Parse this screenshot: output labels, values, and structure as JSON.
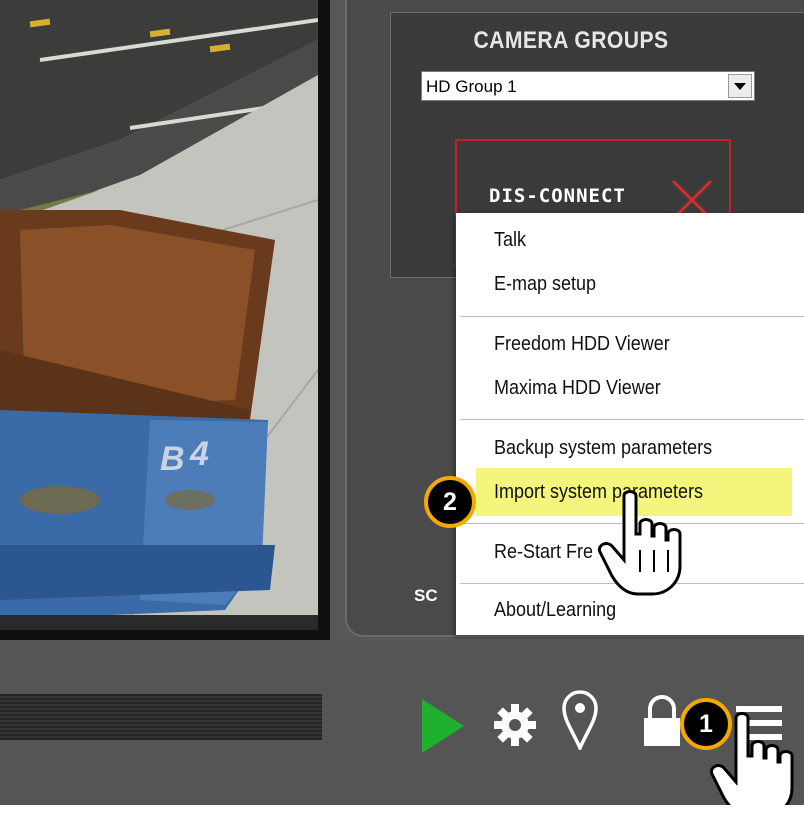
{
  "camera_groups": {
    "title": "CAMERA GROUPS",
    "selected_group": "HD Group 1"
  },
  "disconnect_label": "DIS-CONNECT",
  "partial_label": "SC",
  "context_menu": {
    "items": [
      {
        "label": "Talk"
      },
      {
        "label": "E-map setup"
      },
      {
        "label": "Freedom HDD Viewer"
      },
      {
        "label": "Maxima HDD Viewer"
      },
      {
        "label": "Backup system parameters"
      },
      {
        "label": "Import system parameters",
        "highlighted": true
      },
      {
        "label": "Re-Start Fre"
      },
      {
        "label": "About/Learning"
      }
    ]
  },
  "toolbar_icons": [
    "play-icon",
    "gear-icon",
    "location-pin-icon",
    "lock-icon",
    "menu-icon"
  ],
  "callouts": {
    "step1": "1",
    "step2": "2"
  },
  "colors": {
    "disconnect_border": "#c41f24",
    "highlight": "#f3f57c",
    "badge_ring": "#f5a800",
    "play": "#1fb02e"
  }
}
